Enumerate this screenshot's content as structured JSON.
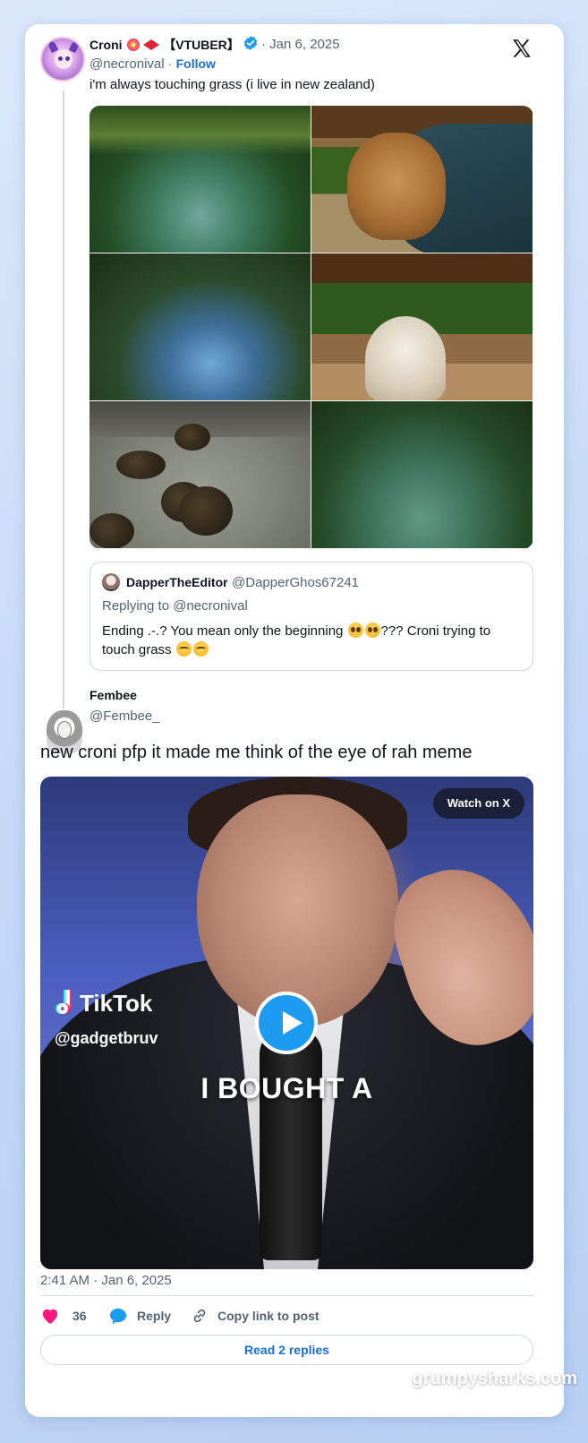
{
  "tweet": {
    "author_name": "Croni",
    "author_badge": "【VTUBER】",
    "date": "Jan 6, 2025",
    "handle": "@necronival",
    "follow_label": "Follow",
    "text": "i'm always touching grass (i live in new zealand)"
  },
  "quote": {
    "author_name": "DapperTheEditor",
    "handle": "@DapperGhos67241",
    "replying_to": "Replying to @necronival",
    "text_part1": "Ending .-.? You mean only the beginning ",
    "text_part2": "??? Croni trying to",
    "text_part3": "touch grass "
  },
  "reply": {
    "author_name": "Fembee",
    "handle": "@Fembee_",
    "text": "new croni pfp it made me think of the eye of rah meme",
    "video": {
      "watch_label": "Watch on X",
      "tiktok_brand": "TikTok",
      "tiktok_handle": "@gadgetbruv",
      "caption": "I BOUGHT A"
    },
    "timestamp": "2:41 AM · Jan 6, 2025"
  },
  "actions": {
    "likes": "36",
    "reply_label": "Reply",
    "copy_label": "Copy link to post",
    "read_replies": "Read 2 replies"
  },
  "icons": [
    "x-logo-icon",
    "verified-badge-icon",
    "heart-icon",
    "reply-icon",
    "link-icon",
    "play-icon"
  ],
  "colors": {
    "accent": "#1d9bf0",
    "link": "#1d6fd3",
    "like": "#f91880"
  },
  "watermark": "grumpysharks.com"
}
